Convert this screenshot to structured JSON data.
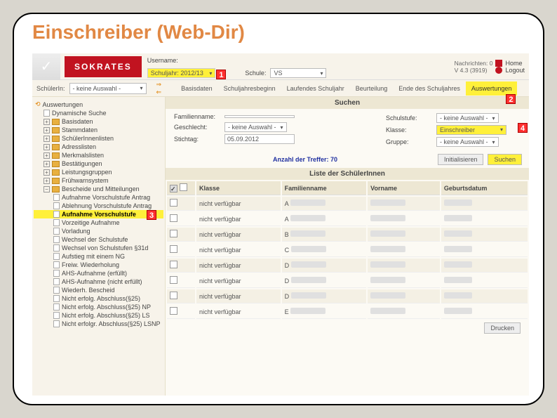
{
  "slide_title": "Einschreiber (Web-Dir)",
  "brand": "SOKRATES",
  "header": {
    "username_label": "Username:",
    "schuljahr_label": "Schuljahr:",
    "schuljahr_value": "2012/13",
    "schule_label": "Schule:",
    "schule_value": "VS",
    "nachrichten": "Nachrichten: 0",
    "version": "V 4.3 (3919)",
    "home": "Home",
    "logout": "Logout"
  },
  "markers": {
    "m1": "1",
    "m2": "2",
    "m3": "3",
    "m4": "4"
  },
  "schuelerin_label": "SchülerIn:",
  "schuelerin_value": "- keine Auswahl -",
  "tabs": {
    "basisdaten": "Basisdaten",
    "schuljahresbeginn": "Schuljahresbeginn",
    "laufendes": "Laufendes Schuljahr",
    "beurteilung": "Beurteilung",
    "ende": "Ende des Schuljahres",
    "auswertungen": "Auswertungen"
  },
  "tree": {
    "root": "Auswertungen",
    "items": [
      "Dynamische Suche",
      "Basisdaten",
      "Stammdaten",
      "SchülerInnenlisten",
      "Adresslisten",
      "Merkmalslisten",
      "Bestätigungen",
      "Leistungsgruppen",
      "Frühwarnsystem",
      "Bescheide und Mitteilungen"
    ],
    "subitems": [
      "Aufnahme Vorschulstufe Antrag",
      "Ablehnung Vorschulstufe Antrag",
      "Aufnahme Vorschulstufe",
      "Vorzeitige Aufnahme",
      "Vorladung",
      "Wechsel der Schulstufe",
      "Wechsel von Schulstufen §31d",
      "Aufstieg mit einem NG",
      "Freiw. Wiederholung",
      "AHS-Aufnahme (erfüllt)",
      "AHS-Aufnahme (nicht erfüllt)",
      "Wiederh. Bescheid",
      "Nicht erfolg. Abschluss(§25)",
      "Nicht erfolg. Abschluss(§25) NP",
      "Nicht erfolg. Abschluss(§25) LS",
      "Nicht erfolgr. Abschluss(§25) LSNP"
    ]
  },
  "search": {
    "title": "Suchen",
    "familienname": "Familienname:",
    "geschlecht": "Geschlecht:",
    "geschlecht_value": "- keine Auswahl -",
    "stichtag": "Stichtag:",
    "stichtag_value": "05.09.2012",
    "schulstufe": "Schulstufe:",
    "schulstufe_value": "- keine Auswahl -",
    "klasse": "Klasse:",
    "klasse_value": "Einschreiber",
    "gruppe": "Gruppe:",
    "gruppe_value": "- keine Auswahl -",
    "count_label": "Anzahl der Treffer:  70",
    "init_btn": "Initialisieren",
    "search_btn": "Suchen"
  },
  "table": {
    "title": "Liste der SchülerInnen",
    "cols": {
      "klasse": "Klasse",
      "familienname": "Familienname",
      "vorname": "Vorname",
      "geburtsdatum": "Geburtsdatum"
    },
    "rows": [
      {
        "status": "nicht verfügbar",
        "k": "A"
      },
      {
        "status": "nicht verfügbar",
        "k": "A"
      },
      {
        "status": "nicht verfügbar",
        "k": "B"
      },
      {
        "status": "nicht verfügbar",
        "k": "C"
      },
      {
        "status": "nicht verfügbar",
        "k": "D"
      },
      {
        "status": "nicht verfügbar",
        "k": "D"
      },
      {
        "status": "nicht verfügbar",
        "k": "D"
      },
      {
        "status": "nicht verfügbar",
        "k": "E"
      }
    ]
  },
  "print_btn": "Drucken"
}
